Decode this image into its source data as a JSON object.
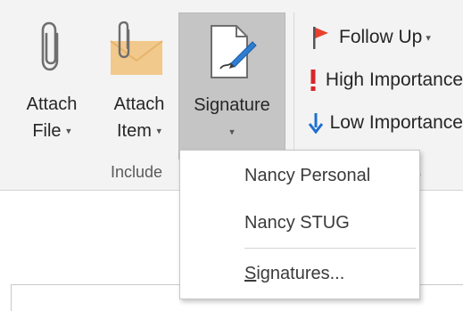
{
  "include_group": {
    "label": "Include",
    "attach_file": {
      "line1": "Attach",
      "line2": "File"
    },
    "attach_item": {
      "line1": "Attach",
      "line2": "Item"
    },
    "signature": {
      "label": "Signature"
    }
  },
  "tags_group": {
    "label_tail": "s",
    "follow_up": "Follow Up",
    "high_importance": "High Importance",
    "low_importance": "Low Importance"
  },
  "signature_menu": {
    "items": [
      "Nancy Personal",
      "Nancy STUG"
    ],
    "signatures_link": {
      "mnemonic": "S",
      "rest": "ignatures..."
    }
  },
  "colors": {
    "flag": "#e8412c",
    "exclamation": "#d9262b",
    "arrow": "#1e6fd0",
    "envelope": "#f2c98c",
    "selected_bg": "#c5c5c5"
  },
  "icons": [
    "paperclip-icon",
    "envelope-paperclip-icon",
    "signature-pen-icon",
    "flag-icon",
    "exclamation-icon",
    "down-arrow-icon",
    "chevron-down-icon"
  ]
}
